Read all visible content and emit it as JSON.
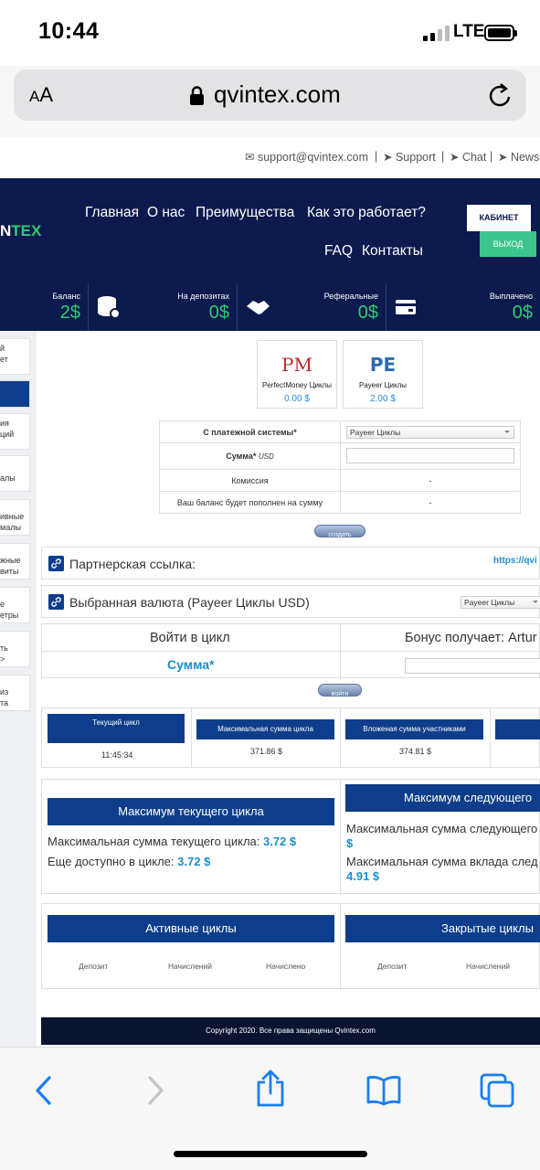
{
  "status": {
    "time": "10:44",
    "network": "LTE"
  },
  "browser": {
    "aa_label": "AA",
    "url": "qvintex.com"
  },
  "toplinks": {
    "email": "support@qvintex.com",
    "support": "Support",
    "chat": "Chat",
    "news": "News",
    "sep": "|"
  },
  "logo": {
    "part1": "N",
    "part2": "TEX"
  },
  "nav": {
    "home": "Главная",
    "about": "О нас",
    "advantages": "Преимущества",
    "how": "Как это работает?",
    "faq": "FAQ",
    "contacts": "Контакты",
    "cabinet": "КАБИНЕТ",
    "exit": "ВЫХОД"
  },
  "stats": [
    {
      "label": "Баланс",
      "value": "2$"
    },
    {
      "label": "На депозитах",
      "value": "0$"
    },
    {
      "label": "Реферальные",
      "value": "0$"
    },
    {
      "label": "Выплачено",
      "value": "0$"
    }
  ],
  "sidebar": [
    "й\nет",
    "",
    "ия\nций",
    "алы",
    "ивные\nмалы",
    "жные\nвиты",
    "е\nетры",
    "ть\n>",
    "из\nта"
  ],
  "payments": [
    {
      "logo": "PM",
      "name": "PerfectMoney Циклы",
      "amount": "0.00 $"
    },
    {
      "logo": "PE",
      "name": "Payeer Циклы",
      "amount": "2.00 $"
    }
  ],
  "form": {
    "system_label": "С платежной системы*",
    "system_value": "Payeer Циклы",
    "amount_label": "Сумма*",
    "amount_unit": "USD",
    "fee_label": "Комиссия",
    "fee_value": "-",
    "credit_label": "Ваш баланс будет пополнен на сумму",
    "credit_value": "-",
    "submit": "создать"
  },
  "partner": {
    "label": "Партнерская ссылка:",
    "link": "https://qvi"
  },
  "currency": {
    "label": "Выбранная валюта (Payeer Циклы USD)",
    "select": "Payeer Циклы"
  },
  "cycle_join": {
    "enter": "Войти в цикл",
    "bonus": "Бонус получает: Artur",
    "amount": "Сумма*",
    "button": "войти"
  },
  "cycle_stats": [
    {
      "header": "Текущий цикл",
      "value": "11:45:34"
    },
    {
      "header": "Максимальная сумма цикла",
      "value": "371.86 $"
    },
    {
      "header": "Вложеная сумма участниками",
      "value": "374.81 $"
    }
  ],
  "max_current": {
    "title": "Максимум текущего цикла",
    "line1": "Максимальная сумма текущего цикла:",
    "val1": "3.72 $",
    "line2": "Еще доступно в цикле:",
    "val2": "3.72 $"
  },
  "max_next": {
    "title": "Максимум следующего",
    "line1": "Максимальная сумма следующего",
    "val1": "$",
    "line2": "Максимальная сумма вклада след",
    "val2": "4.91 $"
  },
  "active_cycles": {
    "title": "Активные циклы",
    "cols": [
      "Депозит",
      "Начислений",
      "Начислено"
    ]
  },
  "closed_cycles": {
    "title": "Закрытые циклы",
    "cols": [
      "Депозит",
      "Начислений"
    ]
  },
  "footer": "Copyright 2020. Все права защищены Qvintex.com",
  "colors": {
    "navy": "#0c1a4d",
    "accent_green": "#2ecc71",
    "link_blue": "#1a8fd1",
    "ios_blue": "#1a7ef2"
  }
}
